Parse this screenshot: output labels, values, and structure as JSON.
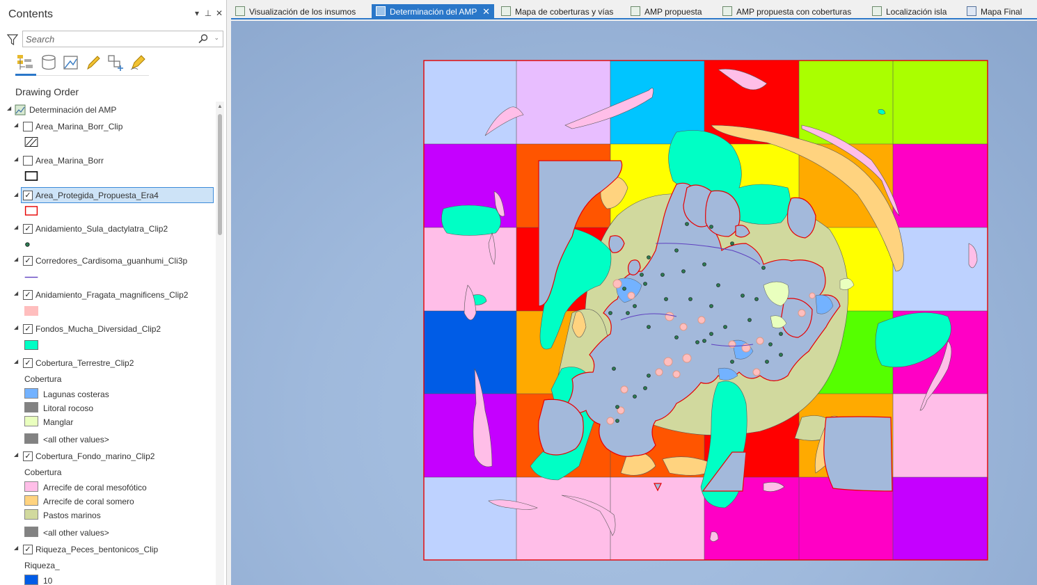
{
  "contents": {
    "title": "Contents",
    "pin_glyph": "▾",
    "pin2_glyph": "⊥",
    "close_glyph": "✕",
    "search_placeholder": "Search",
    "drawing_order": "Drawing Order",
    "tools": [
      "list-by-drawing-order-icon",
      "list-by-source-icon",
      "list-by-selection-icon",
      "list-by-editing-icon",
      "list-by-snapping-icon",
      "list-by-labeling-icon"
    ]
  },
  "layers": {
    "map_name": "Determinación del AMP",
    "area_clip": "Area_Marina_Borr_Clip",
    "area_borr": "Area_Marina_Borr",
    "area_protegida": "Area_Protegida_Propuesta_Era4",
    "sula": "Anidamiento_Sula_dactylatra_Clip2",
    "corredores": "Corredores_Cardisoma_guanhumi_Cli3p",
    "fragata": "Anidamiento_Fragata_magnificens_Clip2",
    "fondos": "Fondos_Mucha_Diversidad_Clip2",
    "cobertura_terrestre": "Cobertura_Terrestre_Clip2",
    "cobertura_fondo": "Cobertura_Fondo_marino_Clip2",
    "riqueza": "Riqueza_Peces_bentonicos_Clip"
  },
  "legend": {
    "cobertura_head_1": "Cobertura",
    "lagunas": "Lagunas costeras",
    "litoral": "Litoral rocoso",
    "manglar": "Manglar",
    "other1": "<all other values>",
    "cobertura_head_2": "Cobertura",
    "mesofotico": "Arrecife de coral mesofótico",
    "somero": "Arrecife de coral somero",
    "pastos": "Pastos marinos",
    "other2": "<all other values>",
    "riqueza_head": "Riqueza_",
    "riqueza_10": "10"
  },
  "colors": {
    "accent": "#2a77c9",
    "fragata": "#ffbebe",
    "fondos": "#00ffc5",
    "lagunas": "#73b2ff",
    "litoral": "#828282",
    "manglar": "#e9ffbe",
    "mesofotico": "#ffbee8",
    "somero": "#ffd37f",
    "pastos": "#d1d99e",
    "riqueza_10": "#005ce6",
    "protegida": "#e60000"
  },
  "tabs": [
    {
      "label": "Visualización de los insumos"
    },
    {
      "label": "Determinación del AMP"
    },
    {
      "label": "Mapa de coberturas y vías"
    },
    {
      "label": "AMP propuesta"
    },
    {
      "label": "AMP propuesta con coberturas"
    },
    {
      "label": "Localización isla"
    },
    {
      "label": "Mapa Final"
    }
  ],
  "tab_close": "✕"
}
